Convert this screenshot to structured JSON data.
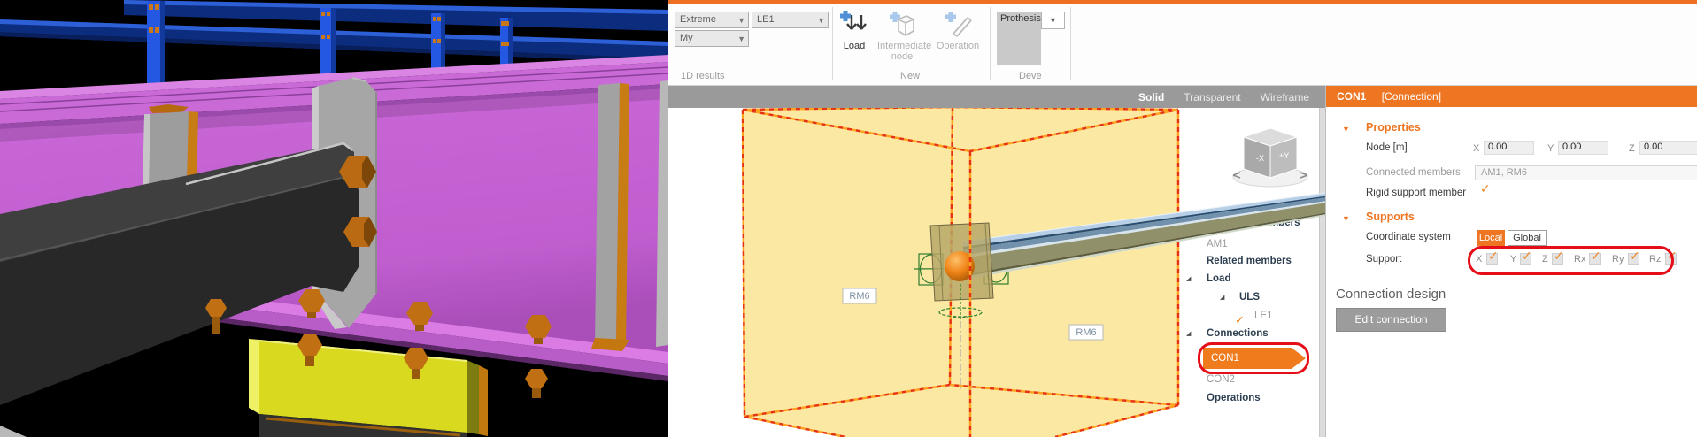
{
  "ribbon": {
    "groups": [
      {
        "label": "1D results"
      },
      {
        "label": "New"
      },
      {
        "label": "Deve"
      }
    ],
    "extreme_dropdown": "Extreme",
    "component_dropdown": "My",
    "loadcase_dropdown": "LE1",
    "load_button": "Load",
    "intermediate_node_line1": "Intermediate",
    "intermediate_node_line2": "node",
    "operation_button": "Operation",
    "prothesis_combo": "Prothesis"
  },
  "view_toolbar": {
    "solid": "Solid",
    "transparent": "Transparent",
    "wireframe": "Wireframe",
    "active": "Solid"
  },
  "scene": {
    "member_label_left": "RM6",
    "member_label_right": "RM6",
    "view_cube_left_face": "-X",
    "view_cube_right_face": "+Y"
  },
  "tree": {
    "items": [
      {
        "label": "Analysed members",
        "style": "bold"
      },
      {
        "label": "AM1",
        "style": "muted"
      },
      {
        "label": "Related members",
        "style": "bold"
      },
      {
        "label": "Load",
        "style": "bold",
        "expanded": true
      },
      {
        "label": "ULS",
        "style": "bold",
        "expanded": true
      },
      {
        "label": "LE1",
        "style": "checked"
      },
      {
        "label": "Connections",
        "style": "bold",
        "expanded": true
      },
      {
        "label": "CON1",
        "style": "selected"
      },
      {
        "label": "CON2",
        "style": "muted"
      },
      {
        "label": "Operations",
        "style": "bold"
      }
    ]
  },
  "panel": {
    "title": "CON1",
    "title_suffix": "[Connection]",
    "properties": {
      "heading": "Properties",
      "node_label": "Node [m]",
      "x_label": "X",
      "x_value": "0.00",
      "y_label": "Y",
      "y_value": "0.00",
      "z_label": "Z",
      "z_value": "0.00",
      "connected_members_label": "Connected members",
      "connected_members_value": "AM1, RM6",
      "rigid_support_label": "Rigid support member",
      "rigid_support_checked": true
    },
    "supports": {
      "heading": "Supports",
      "coordinate_system_label": "Coordinate system",
      "local_option": "Local",
      "global_option": "Global",
      "active_system": "Local",
      "support_label": "Support",
      "dof": [
        {
          "label": "X",
          "checked": true
        },
        {
          "label": "Y",
          "checked": true
        },
        {
          "label": "Z",
          "checked": true
        },
        {
          "label": "Rx",
          "checked": true
        },
        {
          "label": "Ry",
          "checked": true
        },
        {
          "label": "Rz",
          "checked": true
        }
      ]
    },
    "connection_design": {
      "heading": "Connection design",
      "edit_button": "Edit connection"
    }
  },
  "colors": {
    "accent_orange": "#ee7623",
    "selection_orange": "#f07b1d",
    "annotation_red": "#e50d18",
    "viewbar_gray": "#9a9a9a",
    "cube_fill_yellow": "#fbe8a3",
    "cube_edge_red": "#e63313",
    "cube_edge_orange": "#ffa21f"
  }
}
